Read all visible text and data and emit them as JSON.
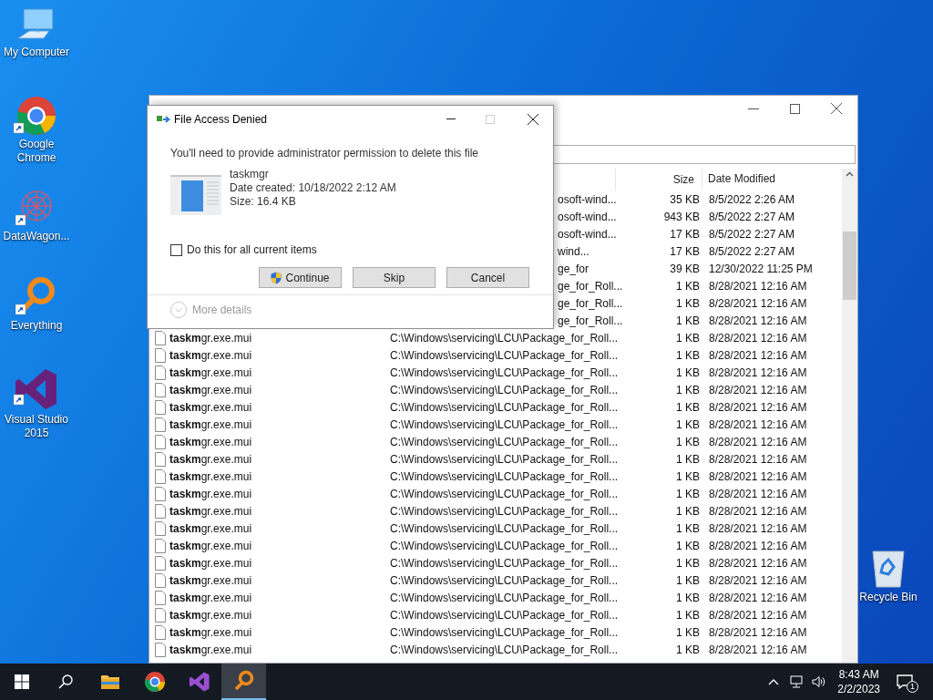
{
  "desktop_icons": [
    {
      "label": "My Computer"
    },
    {
      "label": "Google Chrome"
    },
    {
      "label": "DataWagon..."
    },
    {
      "label": "Everything"
    },
    {
      "label": "Visual Studio 2015"
    },
    {
      "label": "Recycle Bin"
    }
  ],
  "search_window": {
    "columns": [
      "Size",
      "Date Modified"
    ],
    "rows": [
      {
        "path": "osoft-wind...",
        "size": "35 KB",
        "modified": "8/5/2022 2:26 AM"
      },
      {
        "path": "osoft-wind...",
        "size": "943 KB",
        "modified": "8/5/2022 2:27 AM"
      },
      {
        "path": "osoft-wind...",
        "size": "17 KB",
        "modified": "8/5/2022 2:27 AM"
      },
      {
        "path": "wind...",
        "size": "17 KB",
        "modified": "8/5/2022 2:27 AM"
      },
      {
        "path": "ge_for",
        "size": "39 KB",
        "modified": "12/30/2022 11:25 PM"
      },
      {
        "path": "ge_for_Roll...",
        "size": "1 KB",
        "modified": "8/28/2021 12:16 AM"
      },
      {
        "path": "ge_for_Roll...",
        "size": "1 KB",
        "modified": "8/28/2021 12:16 AM"
      },
      {
        "path": "ge_for_Roll...",
        "size": "1 KB",
        "modified": "8/28/2021 12:16 AM"
      },
      {
        "name": "**taskm**gr.exe.mui",
        "path": "C:\\Windows\\servicing\\LCU\\Package_for_Roll...",
        "size": "1 KB",
        "modified": "8/28/2021 12:16 AM"
      },
      {
        "name": "**taskm**gr.exe.mui",
        "path": "C:\\Windows\\servicing\\LCU\\Package_for_Roll...",
        "size": "1 KB",
        "modified": "8/28/2021 12:16 AM"
      },
      {
        "name": "**taskm**gr.exe.mui",
        "path": "C:\\Windows\\servicing\\LCU\\Package_for_Roll...",
        "size": "1 KB",
        "modified": "8/28/2021 12:16 AM"
      },
      {
        "name": "**taskm**gr.exe.mui",
        "path": "C:\\Windows\\servicing\\LCU\\Package_for_Roll...",
        "size": "1 KB",
        "modified": "8/28/2021 12:16 AM"
      },
      {
        "name": "**taskm**gr.exe.mui",
        "path": "C:\\Windows\\servicing\\LCU\\Package_for_Roll...",
        "size": "1 KB",
        "modified": "8/28/2021 12:16 AM"
      },
      {
        "name": "**taskm**gr.exe.mui",
        "path": "C:\\Windows\\servicing\\LCU\\Package_for_Roll...",
        "size": "1 KB",
        "modified": "8/28/2021 12:16 AM"
      },
      {
        "name": "**taskm**gr.exe.mui",
        "path": "C:\\Windows\\servicing\\LCU\\Package_for_Roll...",
        "size": "1 KB",
        "modified": "8/28/2021 12:16 AM"
      },
      {
        "name": "**taskm**gr.exe.mui",
        "path": "C:\\Windows\\servicing\\LCU\\Package_for_Roll...",
        "size": "1 KB",
        "modified": "8/28/2021 12:16 AM"
      },
      {
        "name": "**taskm**gr.exe.mui",
        "path": "C:\\Windows\\servicing\\LCU\\Package_for_Roll...",
        "size": "1 KB",
        "modified": "8/28/2021 12:16 AM"
      },
      {
        "name": "**taskm**gr.exe.mui",
        "path": "C:\\Windows\\servicing\\LCU\\Package_for_Roll...",
        "size": "1 KB",
        "modified": "8/28/2021 12:16 AM"
      },
      {
        "name": "**taskm**gr.exe.mui",
        "path": "C:\\Windows\\servicing\\LCU\\Package_for_Roll...",
        "size": "1 KB",
        "modified": "8/28/2021 12:16 AM"
      },
      {
        "name": "**taskm**gr.exe.mui",
        "path": "C:\\Windows\\servicing\\LCU\\Package_for_Roll...",
        "size": "1 KB",
        "modified": "8/28/2021 12:16 AM"
      },
      {
        "name": "**taskm**gr.exe.mui",
        "path": "C:\\Windows\\servicing\\LCU\\Package_for_Roll...",
        "size": "1 KB",
        "modified": "8/28/2021 12:16 AM"
      },
      {
        "name": "**taskm**gr.exe.mui",
        "path": "C:\\Windows\\servicing\\LCU\\Package_for_Roll...",
        "size": "1 KB",
        "modified": "8/28/2021 12:16 AM"
      },
      {
        "name": "**taskm**gr.exe.mui",
        "path": "C:\\Windows\\servicing\\LCU\\Package_for_Roll...",
        "size": "1 KB",
        "modified": "8/28/2021 12:16 AM"
      },
      {
        "name": "**taskm**gr.exe.mui",
        "path": "C:\\Windows\\servicing\\LCU\\Package_for_Roll...",
        "size": "1 KB",
        "modified": "8/28/2021 12:16 AM"
      },
      {
        "name": "**taskm**gr.exe.mui",
        "path": "C:\\Windows\\servicing\\LCU\\Package_for_Roll...",
        "size": "1 KB",
        "modified": "8/28/2021 12:16 AM"
      },
      {
        "name": "**taskm**gr.exe.mui",
        "path": "C:\\Windows\\servicing\\LCU\\Package_for_Roll...",
        "size": "1 KB",
        "modified": "8/28/2021 12:16 AM"
      },
      {
        "name": "**taskm**gr.exe.mui",
        "path": "C:\\Windows\\servicing\\LCU\\Package_for_Roll...",
        "size": "1 KB",
        "modified": "8/28/2021 12:16 AM"
      }
    ]
  },
  "dialog": {
    "title": "File Access Denied",
    "message": "You'll need to provide administrator permission to delete this file",
    "file": {
      "name": "taskmgr",
      "date_created": "Date created: 10/18/2022 2:12 AM",
      "size": "Size: 16.4 KB"
    },
    "checkbox": {
      "label": "Do this for all current items",
      "checked": false
    },
    "buttons": [
      {
        "label": "Continue",
        "kind": "elevated"
      },
      {
        "label": "Skip",
        "kind": "plain"
      },
      {
        "label": "Cancel",
        "kind": "plain"
      }
    ],
    "more_details": {
      "label": "More details",
      "disabled": true
    }
  },
  "taskbar": {
    "apps": [
      {
        "selected": false
      },
      {
        "selected": false
      },
      {
        "selected": false
      },
      {
        "selected": true
      }
    ],
    "time": "8:43 AM",
    "date": "2/2/2023",
    "notifications": "1"
  }
}
